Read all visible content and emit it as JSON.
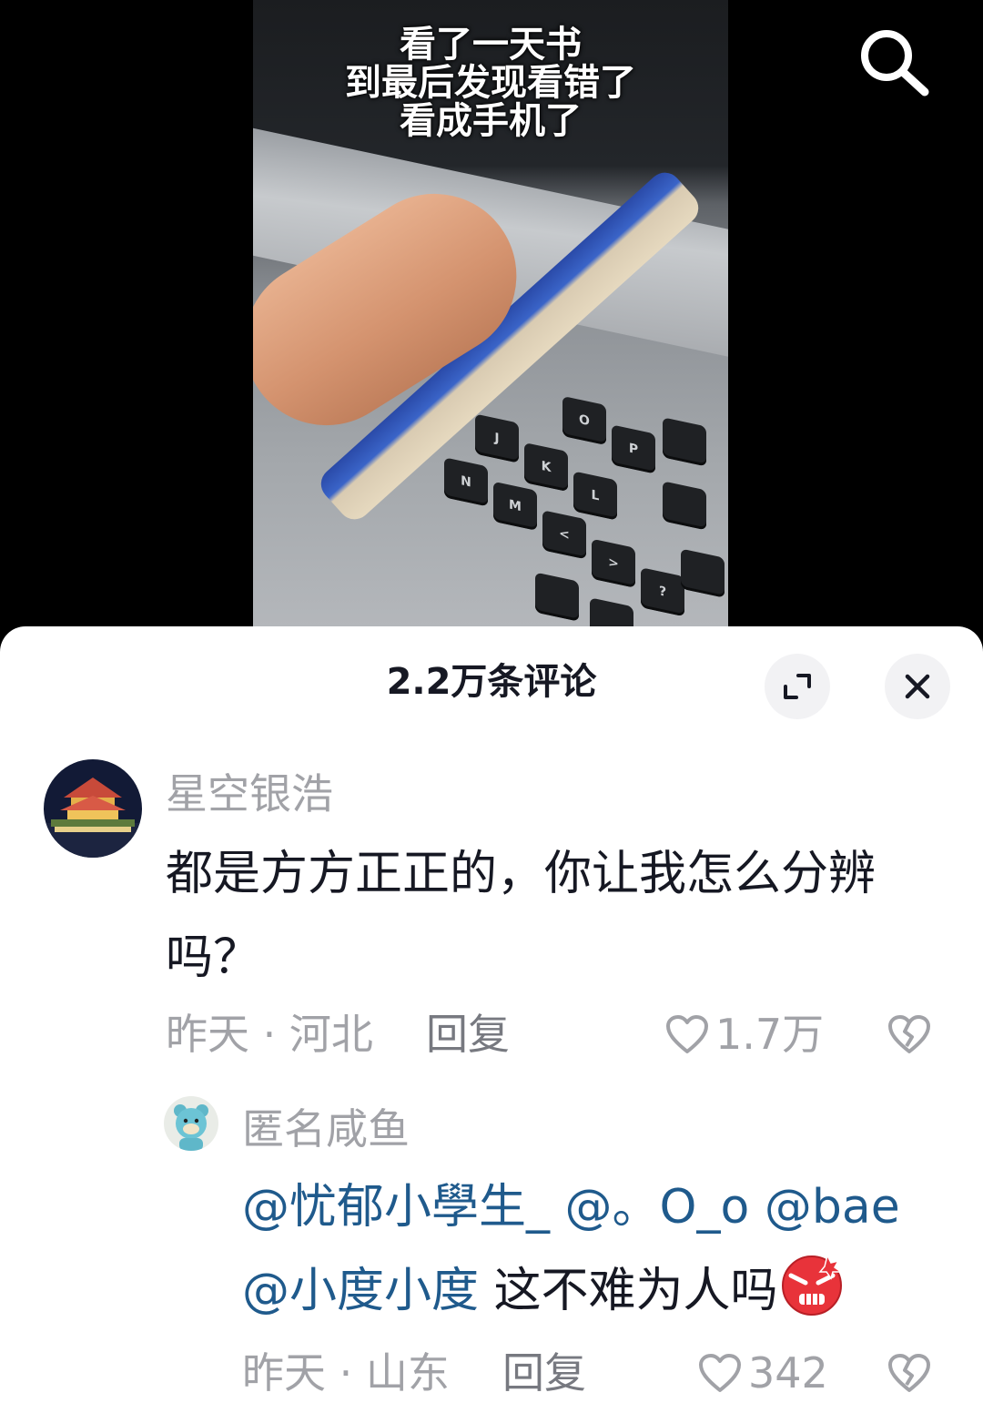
{
  "video": {
    "caption_lines": [
      "看了一天书",
      "到最后发现看错了",
      "看成手机了"
    ],
    "keyboard_keys": [
      "O",
      "P",
      "J",
      "K",
      "L",
      "N",
      "M",
      "<",
      ">",
      "?"
    ]
  },
  "top_bar": {
    "search_icon": "search-icon"
  },
  "comments_panel": {
    "title": "2.2万条评论",
    "expand_icon": "expand-icon",
    "close_icon": "close-icon",
    "comments": [
      {
        "username": "星空银浩",
        "text": "都是方方正正的，你让我怎么分辨吗？",
        "time": "昨天",
        "location": "河北",
        "reply_label": "回复",
        "likes": "1.7万"
      }
    ],
    "reply": {
      "username": "匿名咸鱼",
      "mentions": [
        "@忧郁小學生_",
        "@。O_o",
        "@bae",
        "@小度小度"
      ],
      "text": "这不难为人吗",
      "emoji": "angry-face-emoji",
      "time": "昨天",
      "location": "山东",
      "reply_label": "回复",
      "likes": "342"
    },
    "separator": "·"
  },
  "colors": {
    "mention": "#1f5a8c",
    "muted_text": "#a1a2a7",
    "primary_text": "#161823",
    "sheet_bg": "#ffffff"
  }
}
